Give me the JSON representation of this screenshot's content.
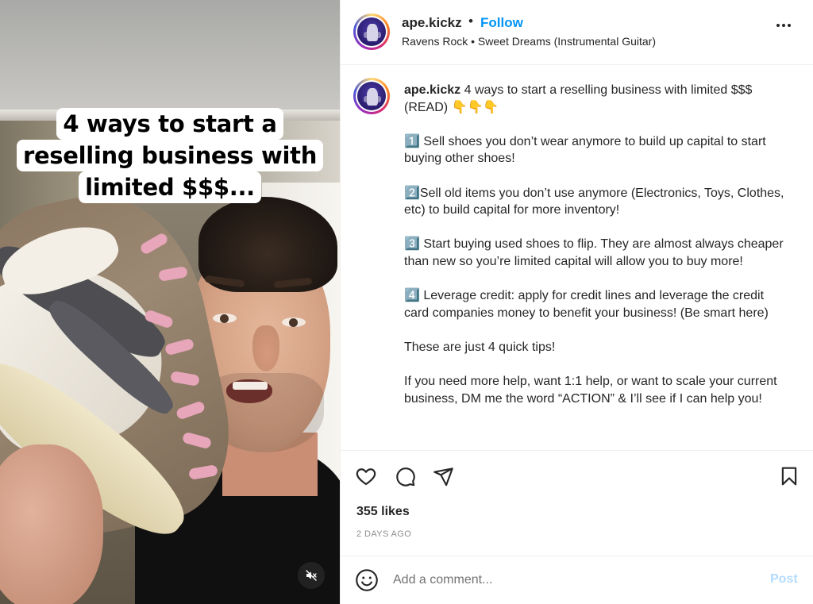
{
  "post": {
    "username": "ape.kickz",
    "follow_label": "Follow",
    "separator": "•",
    "audio_line": "Ravens Rock • Sweet Dreams (Instrumental Guitar)",
    "more_icon": "more-horizontal-icon"
  },
  "media": {
    "caption_lines": [
      "4 ways to start a",
      "reselling business with",
      "limited $$$..."
    ],
    "mute_icon": "speaker-muted-icon"
  },
  "caption": {
    "username": "ape.kickz",
    "text": " 4 ways to start a reselling business with limited $$$ (READ) 👇👇👇\n\n1️⃣ Sell shoes you don’t wear anymore to build up capital to start buying other shoes!\n\n2️⃣Sell old items you don’t use anymore (Electronics, Toys, Clothes, etc) to build capital for more inventory!\n\n3️⃣ Start buying used shoes to flip. They are almost always cheaper than new so you’re limited capital will allow you to buy more!\n\n4️⃣ Leverage credit: apply for credit lines and leverage the credit card companies money to benefit your business! (Be smart here)\n\nThese are just 4 quick tips!\n\nIf you need more help, want 1:1 help, or want to scale your current business, DM me the word “ACTION” & I’ll see if I can help you!"
  },
  "actions": {
    "like_icon": "heart-icon",
    "comment_icon": "comment-icon",
    "share_icon": "send-icon",
    "save_icon": "bookmark-icon"
  },
  "stats": {
    "likes": "355 likes",
    "time_ago": "2 DAYS AGO"
  },
  "comment_box": {
    "emoji_icon": "emoji-icon",
    "placeholder": "Add a comment...",
    "post_label": "Post"
  },
  "colors": {
    "link_blue": "#0095f6",
    "post_disabled": "#b3dbff",
    "muted_text": "#8e8e8e"
  }
}
